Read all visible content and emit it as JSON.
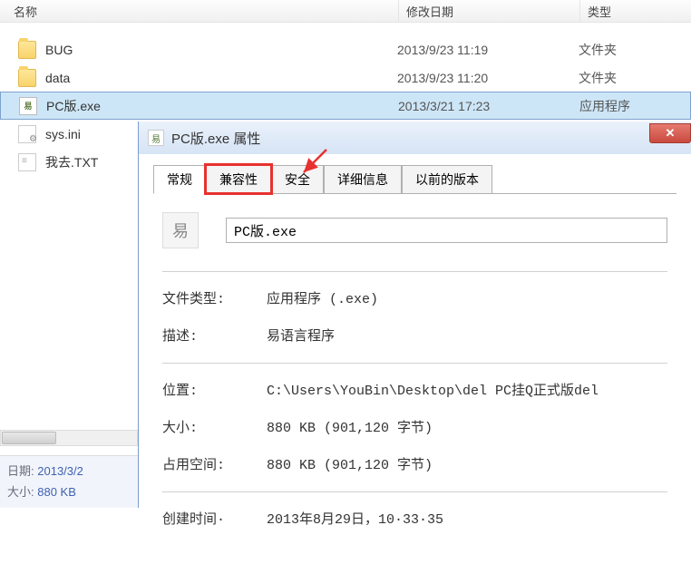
{
  "explorer": {
    "columns": {
      "name": "名称",
      "date": "修改日期",
      "type": "类型"
    },
    "files": [
      {
        "icon": "folder",
        "name": "BUG",
        "date": "2013/9/23 11:19",
        "type": "文件夹",
        "selected": false
      },
      {
        "icon": "folder",
        "name": "data",
        "date": "2013/9/23 11:20",
        "type": "文件夹",
        "selected": false
      },
      {
        "icon": "exe",
        "name": "PC版.exe",
        "date": "2013/3/21 17:23",
        "type": "应用程序",
        "selected": true
      },
      {
        "icon": "ini",
        "name": "sys.ini",
        "date": "",
        "type": "",
        "selected": false
      },
      {
        "icon": "txt",
        "name": "我去.TXT",
        "date": "",
        "type": "",
        "selected": false
      }
    ],
    "status": {
      "date_label": "日期:",
      "date_value": "2013/3/2",
      "size_label": "大小:",
      "size_value": "880 KB"
    }
  },
  "dialog": {
    "title": "PC版.exe 属性",
    "tabs": [
      {
        "label": "常规",
        "active": true,
        "highlighted": false
      },
      {
        "label": "兼容性",
        "active": false,
        "highlighted": true
      },
      {
        "label": "安全",
        "active": false,
        "highlighted": false
      },
      {
        "label": "详细信息",
        "active": false,
        "highlighted": false
      },
      {
        "label": "以前的版本",
        "active": false,
        "highlighted": false
      }
    ],
    "file_name": "PC版.exe",
    "properties": [
      {
        "label": "文件类型:",
        "value": "应用程序 (.exe)"
      },
      {
        "label": "描述:",
        "value": "易语言程序"
      }
    ],
    "divider1": true,
    "location_props": [
      {
        "label": "位置:",
        "value": "C:\\Users\\YouBin\\Desktop\\del PC挂Q正式版del"
      },
      {
        "label": "大小:",
        "value": "880 KB (901,120 字节)"
      },
      {
        "label": "占用空间:",
        "value": "880 KB (901,120 字节)"
      }
    ],
    "divider2": true,
    "bottom_props": [
      {
        "label": "创建时间·",
        "value": "2013年8月29日，10·33·35"
      }
    ]
  }
}
